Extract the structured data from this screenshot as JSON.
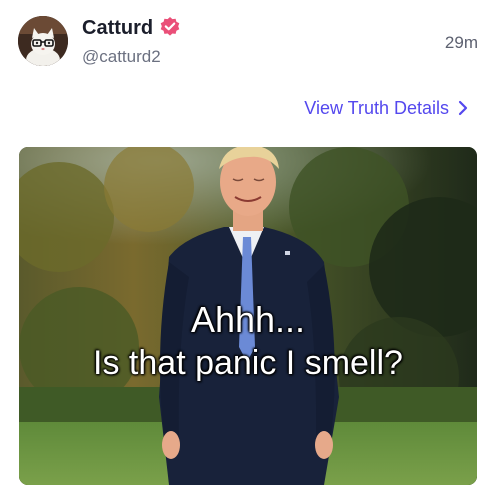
{
  "post": {
    "author": {
      "display_name": "Catturd",
      "handle": "@catturd2",
      "verified": true,
      "avatar_icon": "cat-avatar"
    },
    "timestamp": "29m",
    "details_link": "View Truth Details",
    "colors": {
      "link": "#5448ee",
      "verified_badge": "#ea4f78"
    },
    "media": {
      "caption_line1": "Ahhh...",
      "caption_line2": "Is that panic I smell?"
    }
  }
}
